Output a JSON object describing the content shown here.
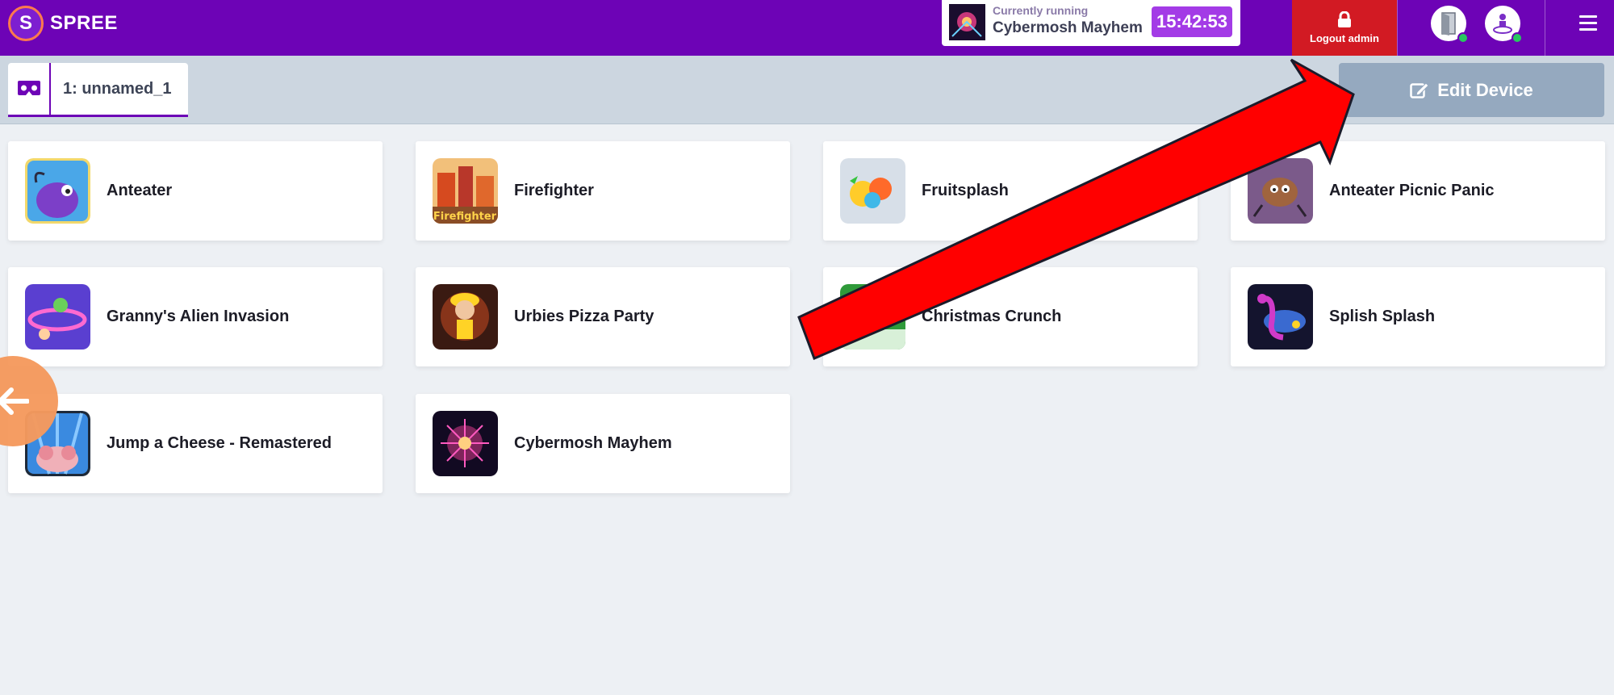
{
  "header": {
    "brand": "SPREE",
    "brand_initial": "S",
    "now_running": {
      "label": "Currently running",
      "game": "Cybermosh Mayhem",
      "time": "15:42:53"
    },
    "logout_label": "Logout admin",
    "icons": [
      "device-status-icon",
      "user-status-icon",
      "menu-icon"
    ]
  },
  "device": {
    "tab_label": "1: unnamed_1",
    "edit_label": "Edit Device"
  },
  "games": [
    {
      "title": "Anteater"
    },
    {
      "title": "Firefighter"
    },
    {
      "title": "Fruitsplash"
    },
    {
      "title": "Anteater Picnic Panic"
    },
    {
      "title": "Granny's Alien Invasion"
    },
    {
      "title": "Urbies Pizza Party"
    },
    {
      "title": "Christmas Crunch"
    },
    {
      "title": "Splish Splash"
    },
    {
      "title": "Jump a Cheese - Remastered"
    },
    {
      "title": "Cybermosh Mayhem"
    }
  ],
  "colors": {
    "brand": "#6d03b6",
    "timer": "#a33be6",
    "logout": "#d21a23",
    "edit_button": "#95a9bf",
    "back_button": "#f59a5e",
    "annotation_arrow": "#ff0000"
  }
}
